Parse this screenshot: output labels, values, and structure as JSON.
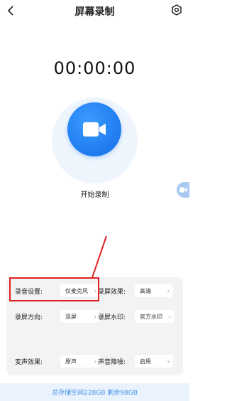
{
  "header": {
    "title": "屏幕录制",
    "back_icon": "back-chevron-icon",
    "settings_icon": "gear-icon"
  },
  "timer": {
    "value": "00:00:00"
  },
  "record": {
    "label": "开始录制",
    "icon": "video-camera-icon",
    "accent": "#1e7bf0"
  },
  "settings": {
    "audio": {
      "label": "录音设置:",
      "value": "仅麦克风"
    },
    "orientation": {
      "label": "录屏方向:",
      "value": "竖屏"
    },
    "voice_effect": {
      "label": "变声效果:",
      "value": "原声"
    },
    "quality": {
      "label": "录屏效果:",
      "value": "高清"
    },
    "watermark": {
      "label": "录屏水印:",
      "value": "官方水印"
    },
    "noise_reduction": {
      "label": "声音降噪:",
      "value": "启用"
    }
  },
  "storage": {
    "text": "总存储空间228GB  剩余98GB"
  },
  "annotation": {
    "highlight_color": "#e02020"
  }
}
